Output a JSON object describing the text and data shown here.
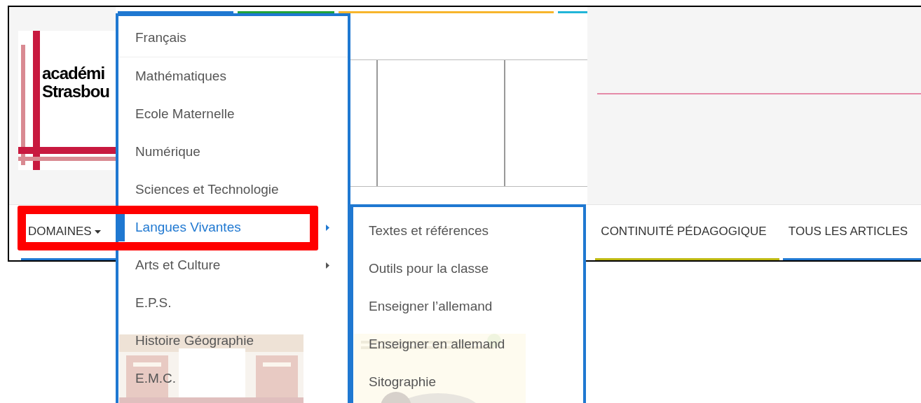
{
  "logo": {
    "lines": [
      "académi",
      "Strasbou"
    ]
  },
  "accent_bars": [
    {
      "color": "#1f78d1"
    },
    {
      "color": "#1fa23a"
    },
    {
      "color": "#f7b52c"
    },
    {
      "color": "#22b5d8"
    }
  ],
  "nav": {
    "items": [
      {
        "label": "DOMAINES",
        "has_menu": true,
        "color": "#1f78d1"
      },
      {
        "label": "CONTINUITÉ PÉDAGOGIQUE",
        "has_menu": false,
        "color": "#bdb80f"
      },
      {
        "label": "TOUS LES ARTICLES",
        "has_menu": false,
        "color": "#1f78d1"
      }
    ]
  },
  "menu": {
    "items": [
      {
        "label": "Français",
        "selected": false,
        "has_submenu": false
      },
      {
        "label": "Mathématiques",
        "selected": false,
        "has_submenu": false
      },
      {
        "label": "Ecole Maternelle",
        "selected": false,
        "has_submenu": false
      },
      {
        "label": "Numérique",
        "selected": false,
        "has_submenu": false
      },
      {
        "label": "Sciences et Technologie",
        "selected": false,
        "has_submenu": false
      },
      {
        "label": "Langues Vivantes",
        "selected": true,
        "has_submenu": true
      },
      {
        "label": "Arts et Culture",
        "selected": false,
        "has_submenu": true
      },
      {
        "label": "E.P.S.",
        "selected": false,
        "has_submenu": false
      },
      {
        "label": "Histoire Géographie",
        "selected": false,
        "has_submenu": false
      },
      {
        "label": "E.M.C.",
        "selected": false,
        "has_submenu": false
      }
    ]
  },
  "submenu": {
    "items": [
      {
        "label": "Textes et références"
      },
      {
        "label": "Outils pour la classe"
      },
      {
        "label": "Enseigner l’allemand"
      },
      {
        "label": "Enseigner en allemand"
      },
      {
        "label": "Sitographie"
      }
    ]
  }
}
